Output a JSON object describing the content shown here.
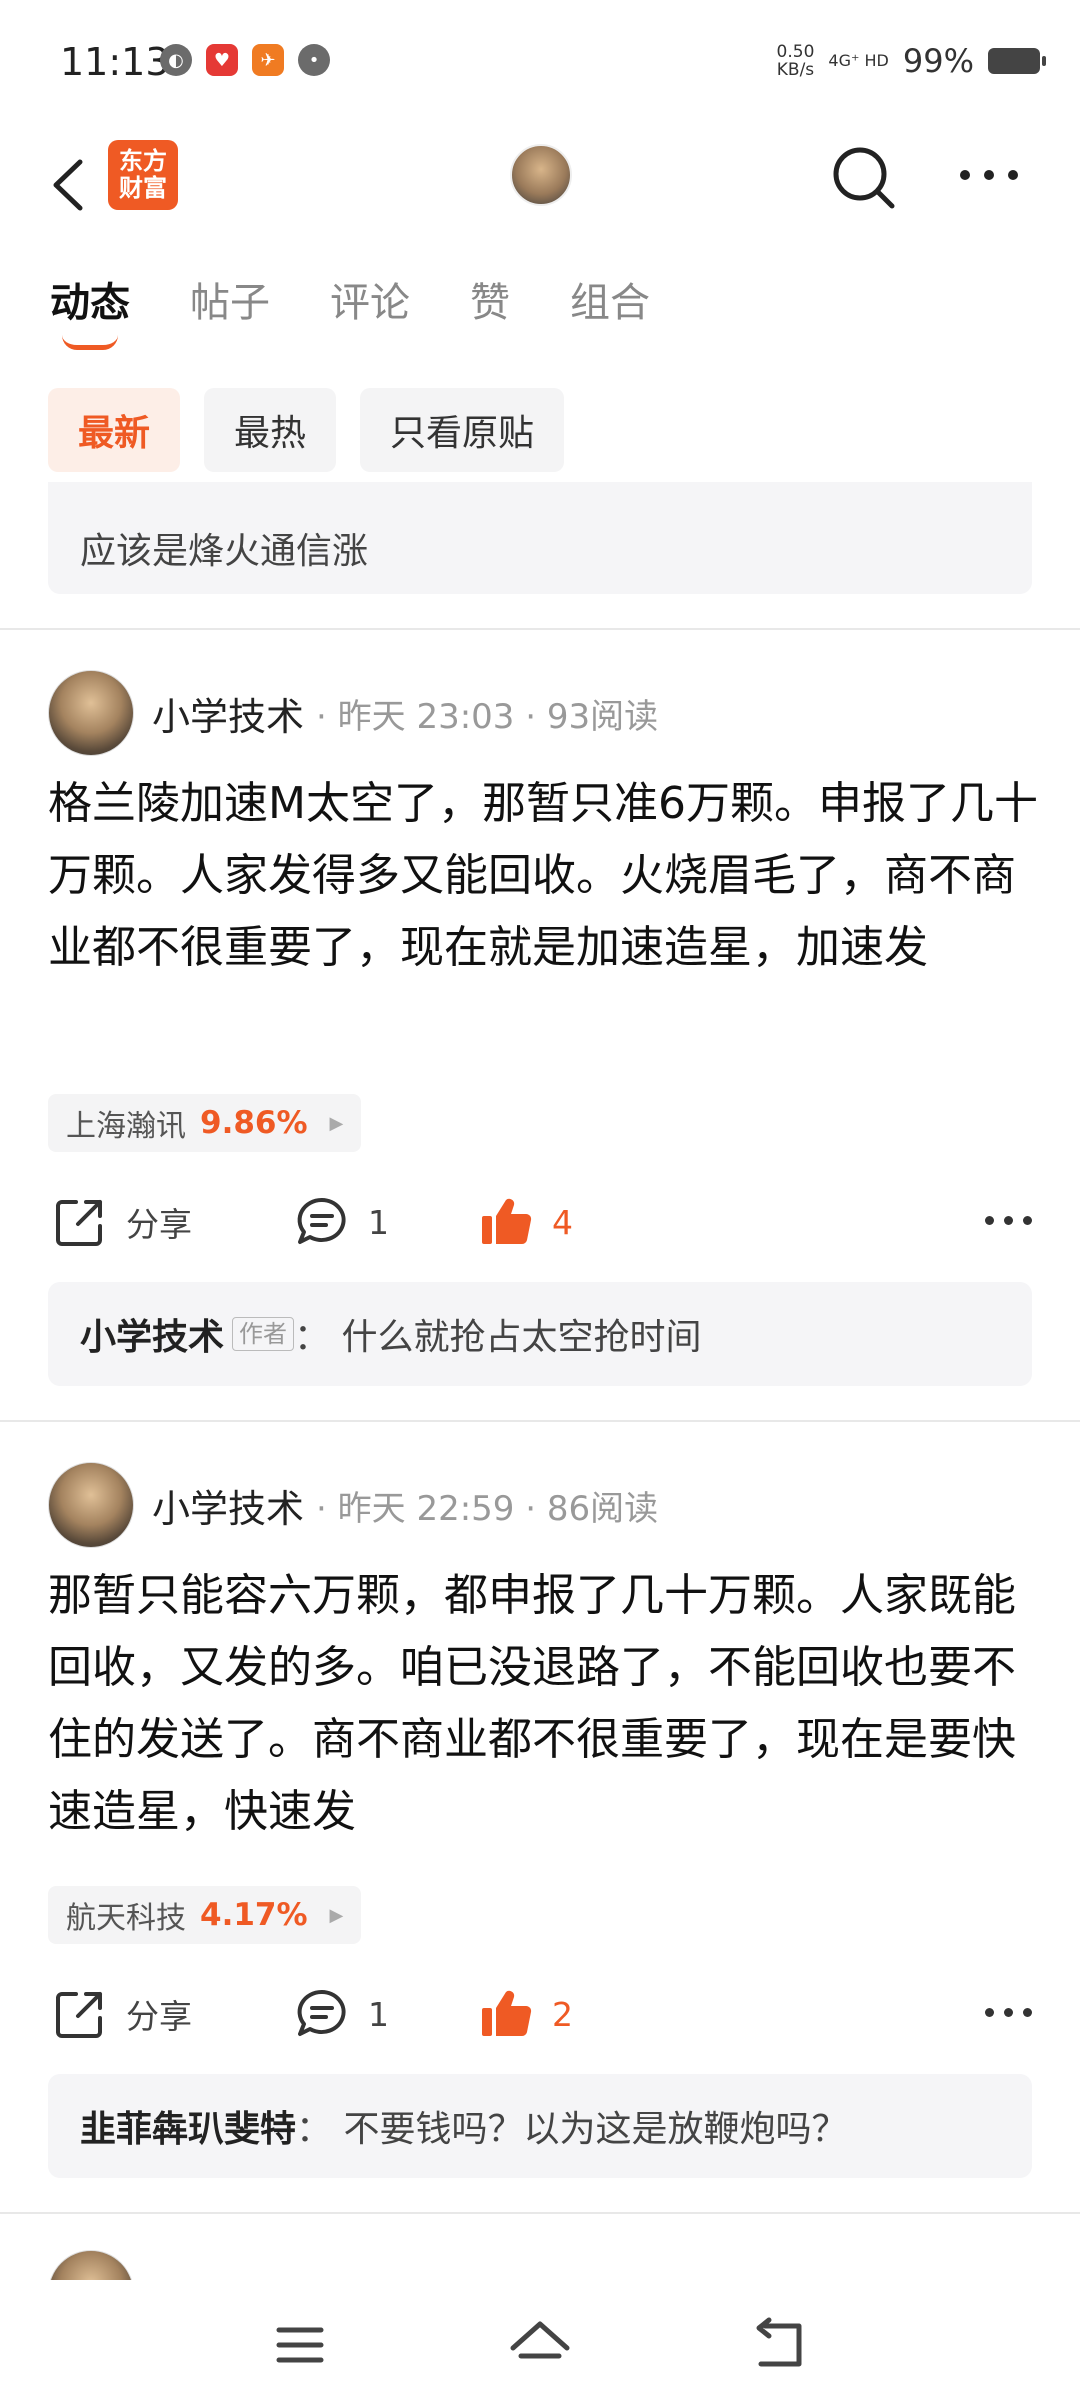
{
  "status_bar": {
    "time": "11:13",
    "net_speed_top": "0.50",
    "net_speed_unit": "KB/s",
    "net_type": "4G⁺ HD",
    "battery": "99%"
  },
  "header": {
    "logo_line1": "东方",
    "logo_line2": "财富"
  },
  "tabs": [
    {
      "label": "动态"
    },
    {
      "label": "帖子"
    },
    {
      "label": "评论"
    },
    {
      "label": "赞"
    },
    {
      "label": "组合"
    }
  ],
  "filters": [
    {
      "label": "最新"
    },
    {
      "label": "最热"
    },
    {
      "label": "只看原贴"
    }
  ],
  "prev_comment": {
    "text": "应该是烽火通信涨"
  },
  "posts": [
    {
      "user": "小学技术",
      "meta": "· 昨天 23:03 · 93阅读",
      "body": "格兰陵加速M太空了，那暂只准6万颗。申报了几十万颗。人家发得多又能回收。火烧眉毛了，商不商业都不很重要了，现在就是加速造星，加速发",
      "stock_name": "上海瀚讯",
      "stock_pct": "9.86%",
      "share_label": "分享",
      "comment_count": "1",
      "like_count": "4",
      "reply_user": "小学技术",
      "reply_badge": "作者",
      "reply_text": "：  什么就抢占太空抢时间"
    },
    {
      "user": "小学技术",
      "meta": "· 昨天 22:59 · 86阅读",
      "body": "那暂只能容六万颗，都申报了几十万颗。人家既能回收，又发的多。咱已没退路了，不能回收也要不住的发送了。商不商业都不很重要了，现在是要快速造星，快速发",
      "stock_name": "航天科技",
      "stock_pct": "4.17%",
      "share_label": "分享",
      "comment_count": "1",
      "like_count": "2",
      "reply_user": "韭菲犇玐斐特",
      "reply_text": "：  不要钱吗？以为这是放鞭炮吗？"
    }
  ],
  "colors": {
    "accent": "#ef5a24",
    "chip_bg": "#f4f4f5"
  }
}
